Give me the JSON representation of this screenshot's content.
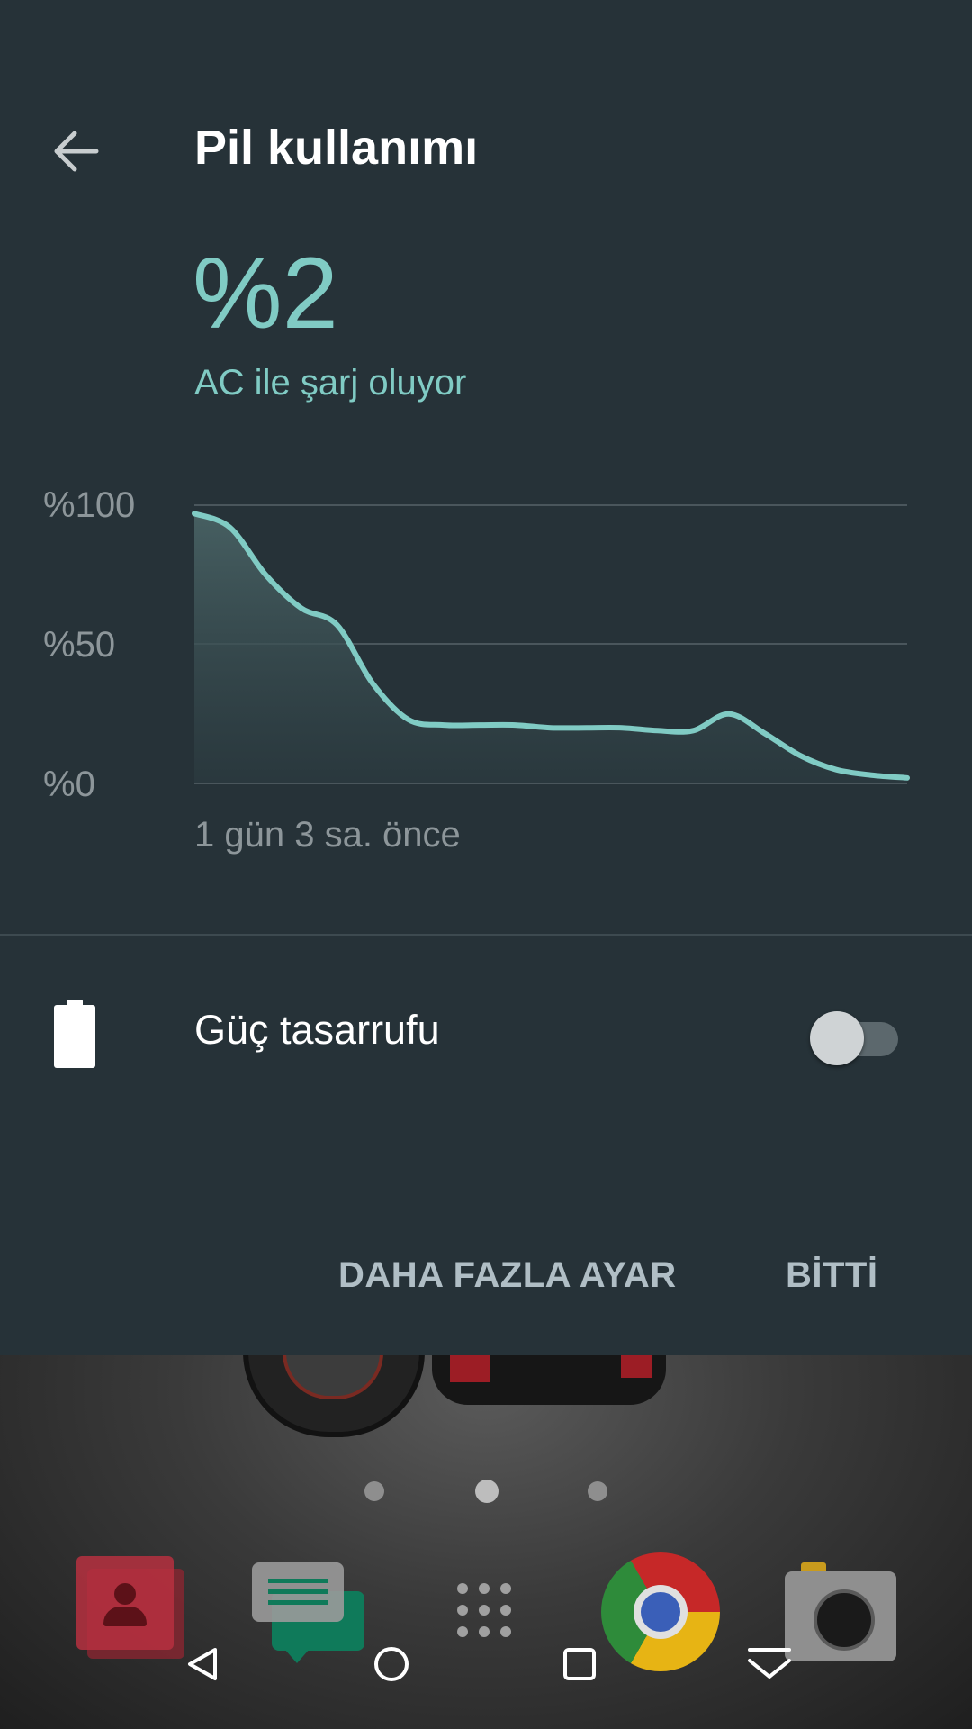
{
  "panel": {
    "title": "Pil kullanımı",
    "battery_percent": "%2",
    "status": "AC ile şarj oluyor",
    "power_saver_label": "Güç tasarrufu",
    "power_saver_on": false,
    "more_settings_label": "DAHA FAZLA AYAR",
    "done_label": "BİTTİ",
    "accent_color": "#80cbc4",
    "background_color": "#263238"
  },
  "chart_data": {
    "type": "area",
    "ylabels": [
      "%100",
      "%50",
      "%0"
    ],
    "xlabel": "1 gün 3 sa. önce",
    "ylim": [
      0,
      100
    ],
    "x_progress": [
      0,
      0.05,
      0.1,
      0.15,
      0.2,
      0.25,
      0.3,
      0.35,
      0.4,
      0.45,
      0.5,
      0.55,
      0.6,
      0.65,
      0.7,
      0.75,
      0.8,
      0.85,
      0.9,
      0.95,
      1.0
    ],
    "y": [
      97,
      92,
      75,
      63,
      57,
      36,
      23,
      21,
      21,
      21,
      20,
      20,
      20,
      19,
      19,
      25,
      18,
      10,
      5,
      3,
      2
    ]
  },
  "home": {
    "page_count": 3,
    "active_page": 1,
    "dock": [
      "contacts-icon",
      "messages-icon",
      "app-drawer-icon",
      "chrome-icon",
      "camera-icon"
    ]
  },
  "navbar": [
    "back-icon",
    "home-icon",
    "recents-icon",
    "collapse-icon"
  ]
}
